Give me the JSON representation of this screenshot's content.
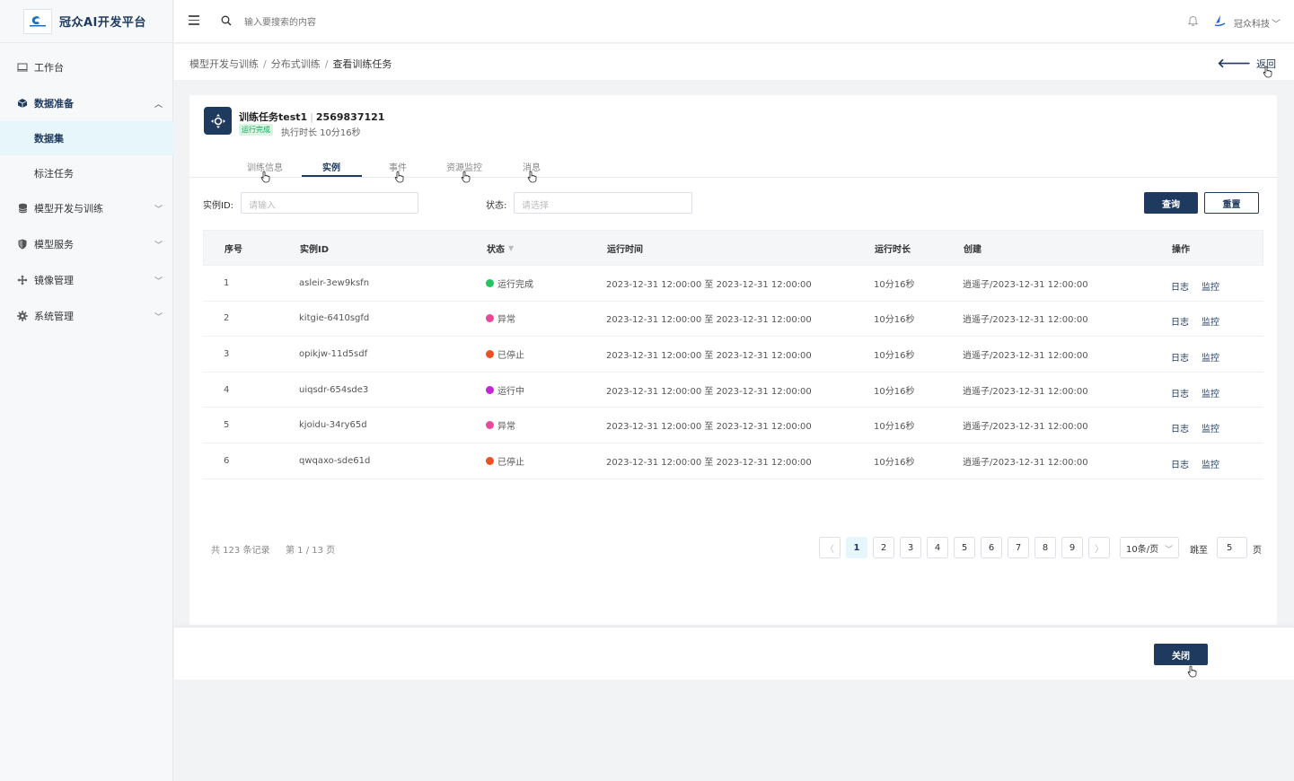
{
  "app": {
    "title": "冠众AI开发平台"
  },
  "sidebar": {
    "items": [
      {
        "label": "工作台",
        "icon": "monitor-icon"
      },
      {
        "label": "数据准备",
        "icon": "cube-icon"
      },
      {
        "label": "数据集"
      },
      {
        "label": "标注任务"
      },
      {
        "label": "模型开发与训练",
        "icon": "database-icon"
      },
      {
        "label": "模型服务",
        "icon": "shield-icon"
      },
      {
        "label": "镜像管理",
        "icon": "move-icon"
      },
      {
        "label": "系统管理",
        "icon": "gear-icon"
      }
    ]
  },
  "header": {
    "search_placeholder": "输入要搜索的内容",
    "user": "冠众科技"
  },
  "breadcrumb": {
    "items": [
      "模型开发与训练",
      "分布式训练",
      "查看训练任务"
    ],
    "back": "返回"
  },
  "task": {
    "name": "训练任务test1",
    "id": "2569837121",
    "status": "运行完成",
    "duration": "执行时长 10分16秒"
  },
  "tabs": [
    "训练信息",
    "实例",
    "事件",
    "资源监控",
    "消息"
  ],
  "filters": {
    "instance_label": "实例ID:",
    "instance_placeholder": "请输入",
    "status_label": "状态:",
    "status_placeholder": "请选择",
    "search_btn": "查询",
    "reset_btn": "重置"
  },
  "table": {
    "headers": [
      "序号",
      "实例ID",
      "状态",
      "运行时间",
      "运行时长",
      "创建",
      "操作"
    ],
    "rows": [
      {
        "no": "1",
        "id": "asleir-3ew9ksfn",
        "status": "运行完成",
        "status_color": "#22c55e",
        "time": "2023-12-31 12:00:00 至 2023-12-31 12:00:00",
        "dur": "10分16秒",
        "created": "逍遥子/2023-12-31 12:00:00",
        "log": "日志",
        "monitor": "监控"
      },
      {
        "no": "2",
        "id": "kitgie-6410sgfd",
        "status": "异常",
        "status_color": "#ec4899",
        "time": "2023-12-31 12:00:00 至 2023-12-31 12:00:00",
        "dur": "10分16秒",
        "created": "逍遥子/2023-12-31 12:00:00",
        "log": "日志",
        "monitor": "监控"
      },
      {
        "no": "3",
        "id": "opikjw-11d5sdf",
        "status": "已停止",
        "status_color": "#f04e23",
        "time": "2023-12-31 12:00:00 至 2023-12-31 12:00:00",
        "dur": "10分16秒",
        "created": "逍遥子/2023-12-31 12:00:00",
        "log": "日志",
        "monitor": "监控"
      },
      {
        "no": "4",
        "id": "uiqsdr-654sde3",
        "status": "运行中",
        "status_color": "#c026d3",
        "time": "2023-12-31 12:00:00 至 2023-12-31 12:00:00",
        "dur": "10分16秒",
        "created": "逍遥子/2023-12-31 12:00:00",
        "log": "日志",
        "monitor": "监控"
      },
      {
        "no": "5",
        "id": "kjoidu-34ry65d",
        "status": "异常",
        "status_color": "#ec4899",
        "time": "2023-12-31 12:00:00 至 2023-12-31 12:00:00",
        "dur": "10分16秒",
        "created": "逍遥子/2023-12-31 12:00:00",
        "log": "日志",
        "monitor": "监控"
      },
      {
        "no": "6",
        "id": "qwqaxo-sde61d",
        "status": "已停止",
        "status_color": "#f04e23",
        "time": "2023-12-31 12:00:00 至 2023-12-31 12:00:00",
        "dur": "10分16秒",
        "created": "逍遥子/2023-12-31 12:00:00",
        "log": "日志",
        "monitor": "监控"
      }
    ]
  },
  "pagination": {
    "total": "共 123 条记录",
    "page_info": "第 1 / 13 页",
    "pages": [
      "1",
      "2",
      "3",
      "4",
      "5",
      "6",
      "7",
      "8",
      "9"
    ],
    "current": "1",
    "page_size": "10条/页",
    "jump_label": "跳至",
    "jump_value": "5",
    "page_suffix": "页"
  },
  "footer": {
    "close": "关闭"
  },
  "colors": {
    "primary": "#1f3a5f",
    "active_bg": "#e6f6fb"
  }
}
